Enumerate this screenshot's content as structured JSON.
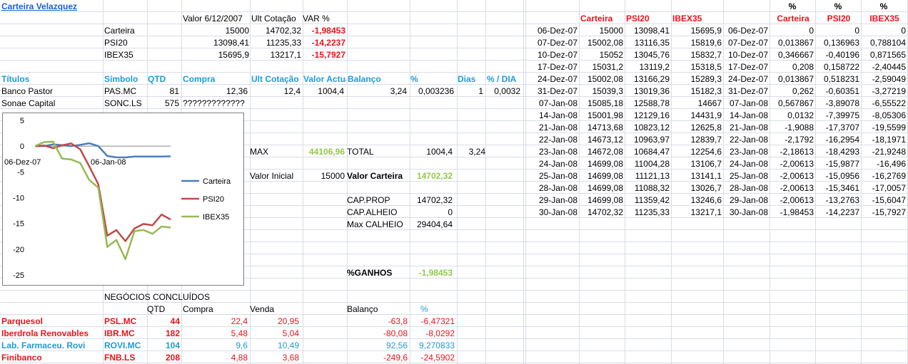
{
  "title": "Carteira Velazquez",
  "summary": {
    "headers": [
      "Valor 6/12/2007",
      "Ult Cotação",
      "VAR %"
    ],
    "rows": [
      [
        "Carteira",
        "15000",
        "14702,32",
        "-1,98453"
      ],
      [
        "PSI20",
        "13098,41",
        "11235,33",
        "-14,2237"
      ],
      [
        "IBEX35",
        "15695,9",
        "13217,1",
        "-15,7927"
      ]
    ]
  },
  "holdings": {
    "headers": [
      "Títulos",
      "Símbolo",
      "QTD",
      "Compra",
      "Ult Cotação",
      "Valor Actual",
      "Balanço",
      "%",
      "Dias",
      "% / DIA"
    ],
    "rows": [
      [
        "Banco Pastor",
        "PAS.MC",
        "81",
        "12,36",
        "12,4",
        "1004,4",
        "3,24",
        "0,003236",
        "1",
        "0,0032"
      ],
      [
        "Sonae Capital",
        "SONC.LS",
        "575",
        "?????????????",
        "",
        "",
        "",
        "",
        "",
        ""
      ]
    ]
  },
  "stats": {
    "max_label": "MAX",
    "max_value": "44106,96",
    "total_label": "TOTAL",
    "total_value": "1004,4",
    "total_balance": "3,24",
    "valor_inicial_label": "Valor Inicial",
    "valor_inicial": "15000",
    "valor_carteira_label": "Valor Carteira",
    "valor_carteira": "14702,32",
    "cap_prop_label": "CAP.PROP",
    "cap_prop": "14702,32",
    "cap_alheio_label": "CAP.ALHEIO",
    "cap_alheio": "0",
    "max_calheio_label": "Max CALHEIO",
    "max_calheio": "29404,64",
    "ganhos_label": "%GANHOS",
    "ganhos": "-1,98453"
  },
  "closed_deals": {
    "title": "NEGÓCIOS CONCLUÍDOS",
    "headers": [
      "QTD",
      "Compra",
      "Venda",
      "Balanço",
      "%"
    ],
    "rows": [
      {
        "name": "Parquesol",
        "symbol": "PSL.MC",
        "qtd": "44",
        "compra": "22,4",
        "venda": "20,95",
        "balanco": "-63,8",
        "pct": "-6,47321",
        "color": "#e8141c"
      },
      {
        "name": "Iberdrola Renovables",
        "symbol": "IBR.MC",
        "qtd": "182",
        "compra": "5,48",
        "venda": "5,04",
        "balanco": "-80,08",
        "pct": "-8,0292",
        "color": "#e8141c"
      },
      {
        "name": "Lab. Farmaceu. Rovi",
        "symbol": "ROVI.MC",
        "qtd": "104",
        "compra": "9,6",
        "venda": "10,49",
        "balanco": "92,56",
        "pct": "9,270833",
        "color": "#1e9bd7"
      },
      {
        "name": "Finibanco",
        "symbol": "FNB.LS",
        "qtd": "208",
        "compra": "4,88",
        "venda": "3,68",
        "balanco": "-249,6",
        "pct": "-24,5902",
        "color": "#e8141c"
      }
    ]
  },
  "history": {
    "headers": [
      "Carteira",
      "PSI20",
      "IBEX35"
    ],
    "pct_prefix": "%",
    "pct_headers": [
      "Carteira",
      "PSI20",
      "IBEX35"
    ],
    "rows": [
      [
        "06-Dez-07",
        "15000",
        "13098,41",
        "15695,9",
        "06-Dez-07",
        "0",
        "0",
        "0"
      ],
      [
        "07-Dez-07",
        "15002,08",
        "13116,35",
        "15819,6",
        "07-Dez-07",
        "0,013867",
        "0,136963",
        "0,788104"
      ],
      [
        "10-Dez-07",
        "15052",
        "13045,76",
        "15832,7",
        "10-Dez-07",
        "0,346667",
        "-0,40196",
        "0,871565"
      ],
      [
        "17-Dez-07",
        "15031,2",
        "13119,2",
        "15318,5",
        "17-Dez-07",
        "0,208",
        "0,158722",
        "-2,40445"
      ],
      [
        "24-Dez-07",
        "15002,08",
        "13166,29",
        "15289,3",
        "24-Dez-07",
        "0,013867",
        "0,518231",
        "-2,59049"
      ],
      [
        "31-Dez-07",
        "15039,3",
        "13019,36",
        "15182,3",
        "31-Dez-07",
        "0,262",
        "-0,60351",
        "-3,27219"
      ],
      [
        "07-Jan-08",
        "15085,18",
        "12588,78",
        "14667",
        "07-Jan-08",
        "0,567867",
        "-3,89078",
        "-6,55522"
      ],
      [
        "14-Jan-08",
        "15001,98",
        "12129,16",
        "14431,9",
        "14-Jan-08",
        "0,0132",
        "-7,39975",
        "-8,05306"
      ],
      [
        "21-Jan-08",
        "14713,68",
        "10823,12",
        "12625,8",
        "21-Jan-08",
        "-1,9088",
        "-17,3707",
        "-19,5599"
      ],
      [
        "22-Jan-08",
        "14673,12",
        "10963,97",
        "12839,7",
        "22-Jan-08",
        "-2,1792",
        "-16,2954",
        "-18,1971"
      ],
      [
        "23-Jan-08",
        "14672,08",
        "10684,47",
        "12254,6",
        "23-Jan-08",
        "-2,18613",
        "-18,4293",
        "-21,9248"
      ],
      [
        "24-Jan-08",
        "14699,08",
        "11004,28",
        "13106,7",
        "24-Jan-08",
        "-2,00613",
        "-15,9877",
        "-16,496"
      ],
      [
        "25-Jan-08",
        "14699,08",
        "11121,13",
        "13141,1",
        "25-Jan-08",
        "-2,00613",
        "-15,0956",
        "-16,2769"
      ],
      [
        "28-Jan-08",
        "14699,08",
        "11088,32",
        "13026,7",
        "28-Jan-08",
        "-2,00613",
        "-15,3461",
        "-17,0057"
      ],
      [
        "29-Jan-08",
        "14699,08",
        "11359,42",
        "13246,6",
        "29-Jan-08",
        "-2,00613",
        "-13,2763",
        "-15,6047"
      ],
      [
        "30-Jan-08",
        "14702,32",
        "11235,33",
        "13217,1",
        "30-Jan-08",
        "-1,98453",
        "-14,2237",
        "-15,7927"
      ]
    ]
  },
  "chart_data": {
    "type": "line",
    "x": [
      "06-Dez-07",
      "07-Dez-07",
      "10-Dez-07",
      "17-Dez-07",
      "24-Dez-07",
      "31-Dez-07",
      "07-Jan-08",
      "14-Jan-08",
      "21-Jan-08",
      "22-Jan-08",
      "23-Jan-08",
      "24-Jan-08",
      "25-Jan-08",
      "28-Jan-08",
      "29-Jan-08",
      "30-Jan-08"
    ],
    "xtick_labels": [
      "06-Dez-07",
      "06-Jan-08"
    ],
    "yticks": [
      "5",
      "0",
      "-5",
      "-10",
      "-15",
      "-20",
      "-25"
    ],
    "ylim": [
      -25,
      5
    ],
    "legend_position": "right",
    "series": [
      {
        "name": "Carteira",
        "color": "#4a7ebb",
        "values": [
          0,
          0.013867,
          0.346667,
          0.208,
          0.013867,
          0.262,
          0.567867,
          0.0132,
          -1.9088,
          -2.1792,
          -2.18613,
          -2.00613,
          -2.00613,
          -2.00613,
          -2.00613,
          -1.98453
        ]
      },
      {
        "name": "PSI20",
        "color": "#be4b48",
        "values": [
          0,
          0.136963,
          -0.40196,
          0.158722,
          0.518231,
          -0.60351,
          -3.89078,
          -7.39975,
          -17.3707,
          -16.2954,
          -18.4293,
          -15.9877,
          -15.0956,
          -15.3461,
          -13.2763,
          -14.2237
        ]
      },
      {
        "name": "IBEX35",
        "color": "#98b954",
        "values": [
          0,
          0.788104,
          0.871565,
          -2.40445,
          -2.59049,
          -3.27219,
          -6.55522,
          -8.05306,
          -19.5599,
          -18.1971,
          -21.9248,
          -16.496,
          -16.2769,
          -17.0057,
          -15.6047,
          -15.7927
        ]
      }
    ]
  }
}
